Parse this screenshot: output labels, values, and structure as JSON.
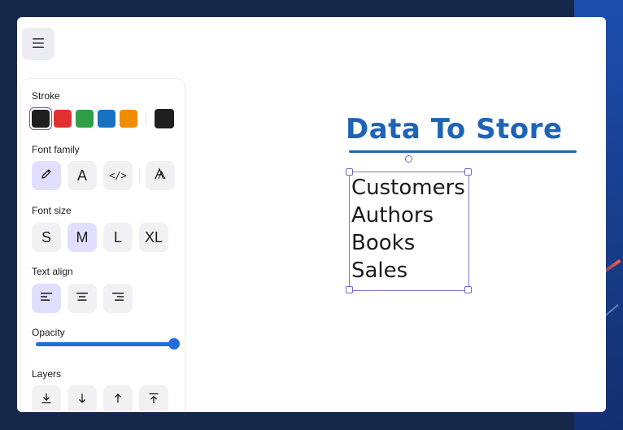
{
  "colors": {
    "accent": "#5b57d1",
    "active_button_bg": "#e0dfff",
    "slider": "#1e6fd9",
    "title_color": "#1e63b8"
  },
  "toolbar": {
    "menu_icon": "hamburger-icon"
  },
  "panel": {
    "stroke": {
      "label": "Stroke",
      "swatches": [
        {
          "name": "black",
          "color": "#1e1e1e",
          "selected": true
        },
        {
          "name": "red",
          "color": "#e03131"
        },
        {
          "name": "green",
          "color": "#2f9e44"
        },
        {
          "name": "blue",
          "color": "#1971c2"
        },
        {
          "name": "orange",
          "color": "#f08c00"
        }
      ],
      "current_color": "#1e1e1e"
    },
    "font_family": {
      "label": "Font family",
      "options": [
        {
          "name": "hand-drawn",
          "icon": "pencil-icon",
          "active": true
        },
        {
          "name": "normal",
          "glyph": "A"
        },
        {
          "name": "code",
          "glyph": "</>"
        },
        {
          "name": "more",
          "icon": "font-more-icon"
        }
      ]
    },
    "font_size": {
      "label": "Font size",
      "options": [
        "S",
        "M",
        "L",
        "XL"
      ],
      "selected": "M"
    },
    "text_align": {
      "label": "Text align",
      "options": [
        "align-left-icon",
        "align-center-icon",
        "align-right-icon"
      ],
      "selected": "align-left-icon"
    },
    "opacity": {
      "label": "Opacity",
      "value": 100
    },
    "layers": {
      "label": "Layers",
      "options": [
        "send-to-back-icon",
        "send-backward-icon",
        "bring-forward-icon",
        "bring-to-front-icon"
      ]
    }
  },
  "canvas": {
    "title": "Data To Store",
    "text_block": {
      "lines": [
        "Customers",
        "Authors",
        "Books",
        "Sales"
      ]
    }
  }
}
